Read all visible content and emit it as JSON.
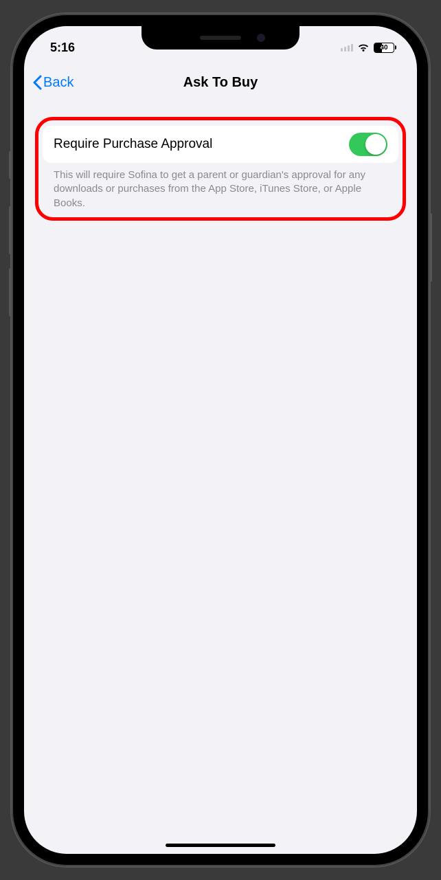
{
  "status": {
    "time": "5:16",
    "battery_pct": "40"
  },
  "nav": {
    "back_label": "Back",
    "title": "Ask To Buy"
  },
  "setting": {
    "label": "Require Purchase Approval",
    "toggle_on": true,
    "description": "This will require Sofina to get a parent or guardian's approval for any downloads or purchases from the App Store, iTunes Store, or Apple Books."
  },
  "colors": {
    "accent": "#007aff",
    "toggle_on": "#34c759",
    "highlight": "#ff0000",
    "background": "#f2f2f7"
  }
}
